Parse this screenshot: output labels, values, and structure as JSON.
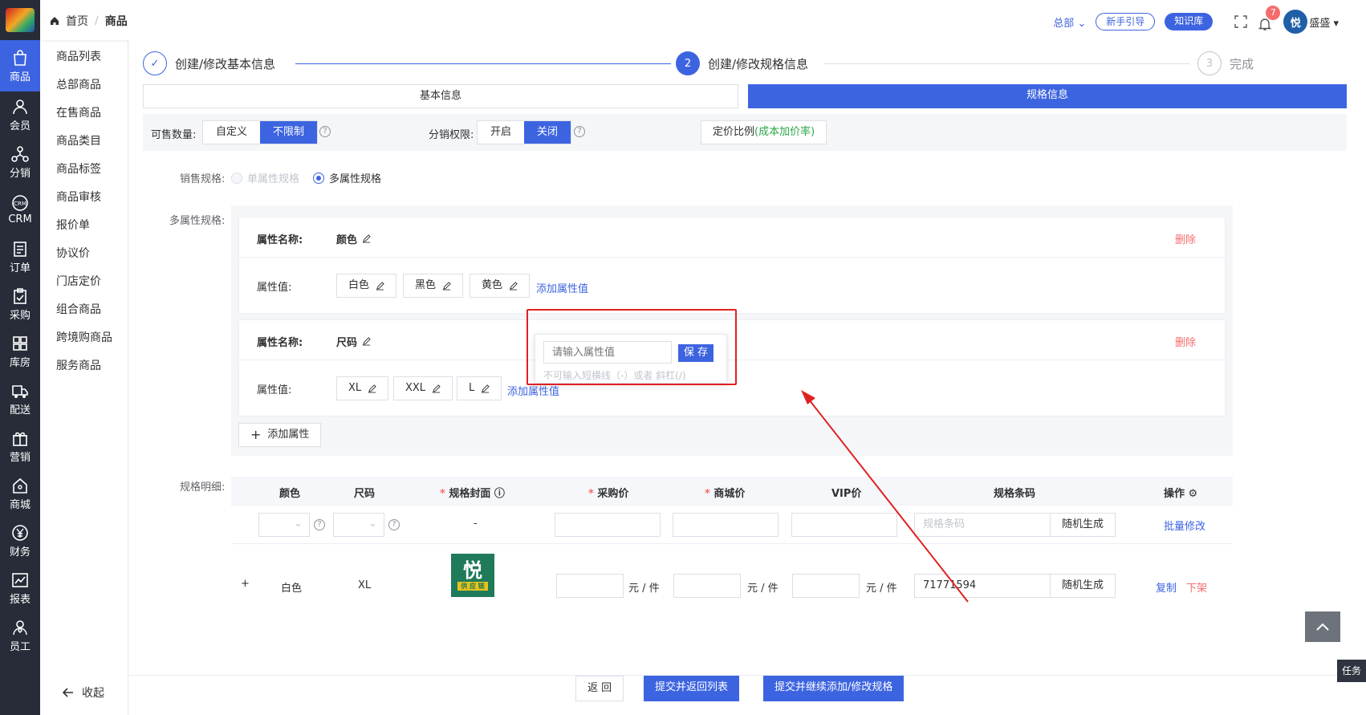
{
  "rail": {
    "items": [
      {
        "label": "商品",
        "icon": "bag-icon"
      },
      {
        "label": "会员",
        "icon": "user-icon"
      },
      {
        "label": "分销",
        "icon": "network-icon"
      },
      {
        "label": "CRM",
        "icon": "crm-icon"
      },
      {
        "label": "订单",
        "icon": "order-icon"
      },
      {
        "label": "采购",
        "icon": "clipboard-icon"
      },
      {
        "label": "库房",
        "icon": "warehouse-icon"
      },
      {
        "label": "配送",
        "icon": "truck-icon"
      },
      {
        "label": "营销",
        "icon": "gift-icon"
      },
      {
        "label": "商城",
        "icon": "home-icon"
      },
      {
        "label": "财务",
        "icon": "yen-icon"
      },
      {
        "label": "报表",
        "icon": "chart-icon"
      },
      {
        "label": "员工",
        "icon": "staff-icon"
      }
    ]
  },
  "submenu": {
    "items": [
      "商品列表",
      "总部商品",
      "在售商品",
      "商品类目",
      "商品标签",
      "商品审核",
      "报价单",
      "协议价",
      "门店定价",
      "组合商品",
      "跨境购商品",
      "服务商品"
    ],
    "collapse": "收起"
  },
  "topbar": {
    "home": "首页",
    "current": "商品",
    "hq": "总部",
    "guide": "新手引导",
    "kb": "知识库",
    "notif_count": "7",
    "user": "盛盛",
    "avatar_char": "悦"
  },
  "steps": {
    "s1": "创建/修改基本信息",
    "s2_num": "2",
    "s2": "创建/修改规格信息",
    "s3_num": "3",
    "s3": "完成"
  },
  "tabs": {
    "basic": "基本信息",
    "spec": "规格信息"
  },
  "filter": {
    "qty_label": "可售数量:",
    "qty_opt1": "自定义",
    "qty_opt2": "不限制",
    "dist_label": "分销权限:",
    "dist_opt1": "开启",
    "dist_opt2": "关闭",
    "price_ratio": "定价比例",
    "price_ratio_note": "(成本加价率)"
  },
  "sale_spec": {
    "label": "销售规格:",
    "single": "单属性规格",
    "multi": "多属性规格"
  },
  "multi_spec": {
    "label": "多属性规格:",
    "name_key": "属性名称:",
    "value_key": "属性值:",
    "delete": "删除",
    "add_value": "添加属性值",
    "add_attr": "添加属性",
    "attrs": [
      {
        "name": "颜色",
        "values": [
          "白色",
          "黑色",
          "黄色"
        ]
      },
      {
        "name": "尺码",
        "values": [
          "XL",
          "XXL",
          "L"
        ]
      }
    ],
    "popup": {
      "placeholder": "请输入属性值",
      "save": "保 存",
      "hint": "不可输入短横线（-）或者 斜杠(/)"
    }
  },
  "detail": {
    "label": "规格明细:",
    "headers": [
      "颜色",
      "尺码",
      "规格封面",
      "采购价",
      "商城价",
      "VIP价",
      "规格条码",
      "操作"
    ],
    "batch_dash": "-",
    "barcode_placeholder": "规格条码",
    "random": "随机生成",
    "batch_edit": "批量修改",
    "row": {
      "plus": "+",
      "color": "白色",
      "size": "XL",
      "unit": "元 / 件",
      "barcode": "71771594",
      "copy": "复制",
      "down": "下架"
    }
  },
  "footer": {
    "back": "返 回",
    "submit_list": "提交并返回列表",
    "submit_continue": "提交并继续添加/修改规格"
  },
  "task": "任务",
  "colors": {
    "primary": "#3d64e0",
    "danger": "#f56c6c",
    "green": "#2aa84a"
  }
}
